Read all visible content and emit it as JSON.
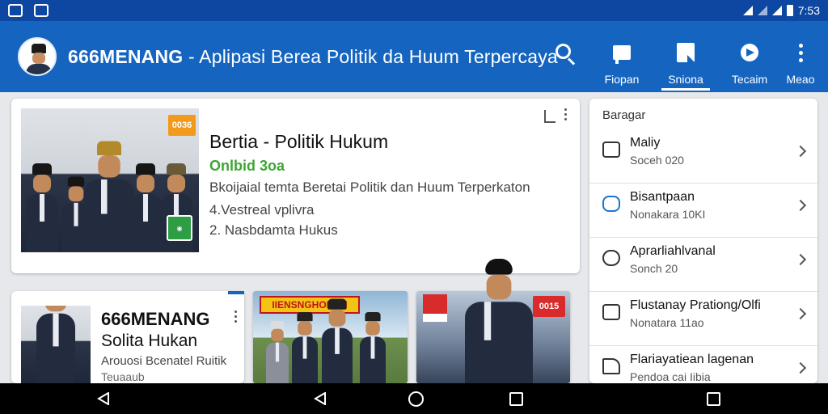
{
  "status_bar": {
    "time": "7:53"
  },
  "app_bar": {
    "title_brand": "666MENANG",
    "title_rest": " - Aplipasi Berea Politik da Huum Terpercaya",
    "actions": [
      {
        "label": "Fiopan",
        "icon": "flag-icon"
      },
      {
        "label": "Sniona",
        "icon": "document-icon"
      },
      {
        "label": "Tecaim",
        "icon": "share-icon"
      },
      {
        "label": "Meao",
        "icon": "more-icon"
      }
    ]
  },
  "main_card": {
    "title": "Bertia - Politik Hukum",
    "subtitle": "Onlbid 3oa",
    "description": "Bkoijaial temta Beretai Politik  dan Huum Terperkaton",
    "line1": "4.Vestreal vplivra",
    "line2": "2. Nasbdamta Hukus",
    "year_badge": "0036"
  },
  "sidebar": {
    "heading": "Baragar",
    "items": [
      {
        "title": "Maliy",
        "subtitle": "Soceh 020"
      },
      {
        "title": "Bisantpaan",
        "subtitle": "Nonakara 10KI"
      },
      {
        "title": "Aprarliahlvanal",
        "subtitle": "Sonch 20"
      },
      {
        "title": "Flustanay Prationg/Olfi",
        "subtitle": "Nonatara 11ao"
      },
      {
        "title": "Flariayatiean lagenan",
        "subtitle": "Pendoa cai Iibia"
      }
    ]
  },
  "small_card": {
    "title1": "666MENANG",
    "title2": "Solita Hukan",
    "description": "Arouosi Bcenatel Ruitik",
    "footer": "Teuaaub"
  },
  "photo_cards": {
    "banner": "IIENSNGHONAN",
    "year_badge": "0015"
  }
}
